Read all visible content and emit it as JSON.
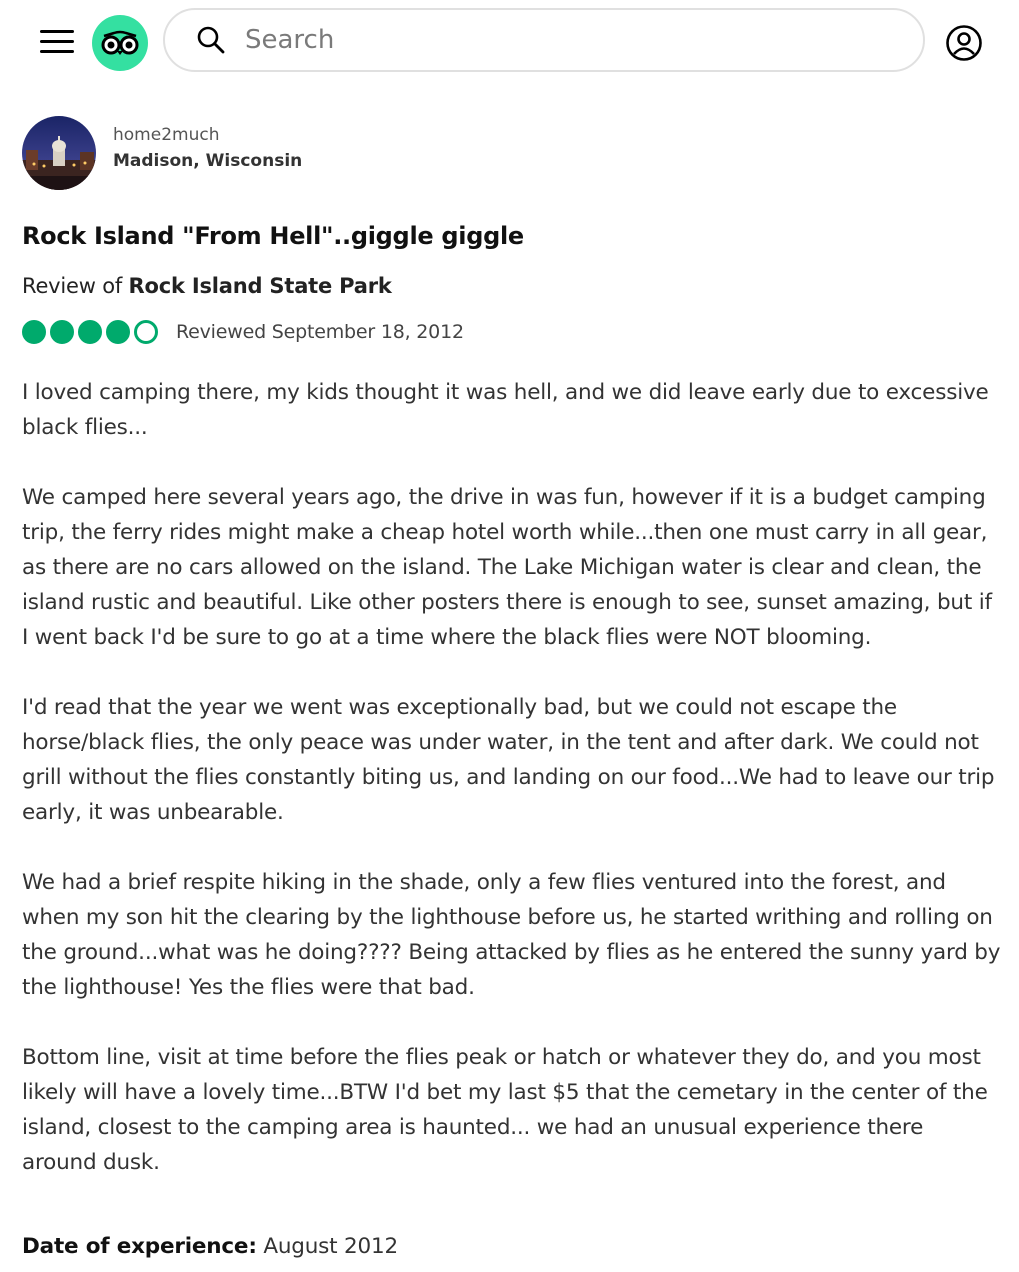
{
  "header": {
    "search_placeholder": "Search"
  },
  "reviewer": {
    "username": "home2much",
    "location": "Madison, Wisconsin"
  },
  "review": {
    "title": "Rock Island \"From Hell\"..giggle giggle",
    "review_of_prefix": "Review of ",
    "place_name": "Rock Island State Park",
    "rating": 4,
    "rating_max": 5,
    "reviewed_date": "Reviewed September 18, 2012",
    "paragraphs": [
      "I loved camping there, my kids thought it was hell, and we did leave early due to excessive black flies...",
      "We camped here several years ago, the drive in was fun, however if it is a budget camping trip, the ferry rides might make a cheap hotel worth while...then one must carry in all gear, as there are no cars allowed on the island. The Lake Michigan water is clear and clean, the island rustic and beautiful. Like other posters there is enough to see, sunset amazing, but if I went back I'd be sure to go at a time where the black flies were NOT blooming.",
      "I'd read that the year we went was exceptionally bad, but we could not escape the horse/black flies, the only peace was under water, in the tent and after dark. We could not grill without the flies constantly biting us, and landing on our food...We had to leave our trip early, it was unbearable.",
      "We had a brief respite hiking in the shade, only a few flies ventured into the forest, and when my son hit the clearing by the lighthouse before us, he started writhing and rolling on the ground...what was he doing???? Being attacked by flies as he entered the sunny yard by the lighthouse! Yes the flies were that bad.",
      "Bottom line, visit at time before the flies peak or hatch or whatever they do, and you most likely will have a lovely time...BTW I'd bet my last $5 that the cemetary in the center of the island, closest to the camping area is haunted... we had an unusual experience there around dusk."
    ],
    "date_of_experience_label": "Date of experience:",
    "date_of_experience_value": " August 2012"
  },
  "colors": {
    "brand_green": "#34e0a1",
    "rating_green": "#00aa6c"
  },
  "icons": {
    "menu": "hamburger-menu-icon",
    "logo": "tripadvisor-owl-logo",
    "search": "search-icon",
    "account": "user-account-icon"
  }
}
